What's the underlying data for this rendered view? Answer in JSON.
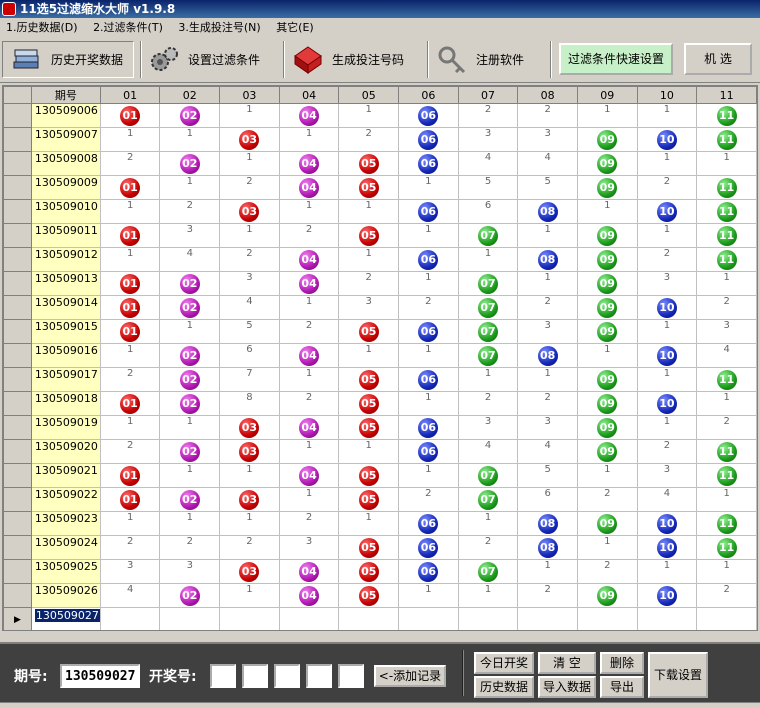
{
  "window": {
    "title": "11选5过滤缩水大师 v1.9.8"
  },
  "menu": [
    "1.历史数据(D)",
    "2.过滤条件(T)",
    "3.生成投注号(N)",
    "其它(E)"
  ],
  "toolbar": {
    "history": "历史开奖数据",
    "filter": "设置过滤条件",
    "generate": "生成投注号码",
    "register": "注册软件",
    "quick_filter": "过滤条件快速设置",
    "random": "机 选"
  },
  "grid": {
    "period_header": "期号",
    "columns": [
      "01",
      "02",
      "03",
      "04",
      "05",
      "06",
      "07",
      "08",
      "09",
      "10",
      "11"
    ],
    "rows": [
      {
        "period": "130509006",
        "cells": [
          "01",
          "02",
          "1",
          "04",
          "1",
          "06",
          "2",
          "2",
          "1",
          "1",
          "11"
        ]
      },
      {
        "period": "130509007",
        "cells": [
          "1",
          "1",
          "03",
          "1",
          "2",
          "06",
          "3",
          "3",
          "09",
          "10",
          "11"
        ]
      },
      {
        "period": "130509008",
        "cells": [
          "2",
          "02",
          "1",
          "04",
          "05",
          "06",
          "4",
          "4",
          "09",
          "1",
          "1"
        ]
      },
      {
        "period": "130509009",
        "cells": [
          "01",
          "1",
          "2",
          "04",
          "05",
          "1",
          "5",
          "5",
          "09",
          "2",
          "11"
        ]
      },
      {
        "period": "130509010",
        "cells": [
          "1",
          "2",
          "03",
          "1",
          "1",
          "06",
          "6",
          "08",
          "1",
          "10",
          "11"
        ]
      },
      {
        "period": "130509011",
        "cells": [
          "01",
          "3",
          "1",
          "2",
          "05",
          "1",
          "07",
          "1",
          "09",
          "1",
          "11"
        ]
      },
      {
        "period": "130509012",
        "cells": [
          "1",
          "4",
          "2",
          "04",
          "1",
          "06",
          "1",
          "08",
          "09",
          "2",
          "11"
        ]
      },
      {
        "period": "130509013",
        "cells": [
          "01",
          "02",
          "3",
          "04",
          "2",
          "1",
          "07",
          "1",
          "09",
          "3",
          "1"
        ]
      },
      {
        "period": "130509014",
        "cells": [
          "01",
          "02",
          "4",
          "1",
          "3",
          "2",
          "07",
          "2",
          "09",
          "10",
          "2"
        ]
      },
      {
        "period": "130509015",
        "cells": [
          "01",
          "1",
          "5",
          "2",
          "05",
          "06",
          "07",
          "3",
          "09",
          "1",
          "3"
        ]
      },
      {
        "period": "130509016",
        "cells": [
          "1",
          "02",
          "6",
          "04",
          "1",
          "1",
          "07",
          "08",
          "1",
          "10",
          "4"
        ]
      },
      {
        "period": "130509017",
        "cells": [
          "2",
          "02",
          "7",
          "1",
          "05",
          "06",
          "1",
          "1",
          "09",
          "1",
          "11"
        ]
      },
      {
        "period": "130509018",
        "cells": [
          "01",
          "02",
          "8",
          "2",
          "05",
          "1",
          "2",
          "2",
          "09",
          "10",
          "1"
        ]
      },
      {
        "period": "130509019",
        "cells": [
          "1",
          "1",
          "03",
          "04",
          "05",
          "06",
          "3",
          "3",
          "09",
          "1",
          "2"
        ]
      },
      {
        "period": "130509020",
        "cells": [
          "2",
          "02",
          "03",
          "1",
          "1",
          "06",
          "4",
          "4",
          "09",
          "2",
          "11"
        ]
      },
      {
        "period": "130509021",
        "cells": [
          "01",
          "1",
          "1",
          "04",
          "05",
          "1",
          "07",
          "5",
          "1",
          "3",
          "11"
        ]
      },
      {
        "period": "130509022",
        "cells": [
          "01",
          "02",
          "03",
          "1",
          "05",
          "2",
          "07",
          "6",
          "2",
          "4",
          "1"
        ]
      },
      {
        "period": "130509023",
        "cells": [
          "1",
          "1",
          "1",
          "2",
          "1",
          "06",
          "1",
          "08",
          "09",
          "10",
          "11"
        ]
      },
      {
        "period": "130509024",
        "cells": [
          "2",
          "2",
          "2",
          "3",
          "05",
          "06",
          "2",
          "08",
          "1",
          "10",
          "11"
        ]
      },
      {
        "period": "130509025",
        "cells": [
          "3",
          "3",
          "03",
          "04",
          "05",
          "06",
          "07",
          "1",
          "2",
          "1",
          "1"
        ]
      },
      {
        "period": "130509026",
        "cells": [
          "4",
          "02",
          "1",
          "04",
          "05",
          "1",
          "1",
          "2",
          "09",
          "10",
          "2"
        ]
      }
    ],
    "current_period": "130509027"
  },
  "colors": {
    "red": "#c40000",
    "purple": "#b018b0",
    "blue": "#1428b8",
    "green": "#1c9a1c",
    "period_bg": "#ffffc0"
  },
  "bottom": {
    "period_label": "期号:",
    "period_value": "130509027",
    "draw_label": "开奖号:",
    "draw_values": [
      "",
      "",
      "",
      "",
      ""
    ],
    "add_record": "<-添加记录",
    "today_draw": "今日开奖",
    "clear": "清 空",
    "delete": "删除",
    "download": "下载设置",
    "history_data": "历史数据",
    "import_data": "导入数据",
    "export": "导出"
  }
}
